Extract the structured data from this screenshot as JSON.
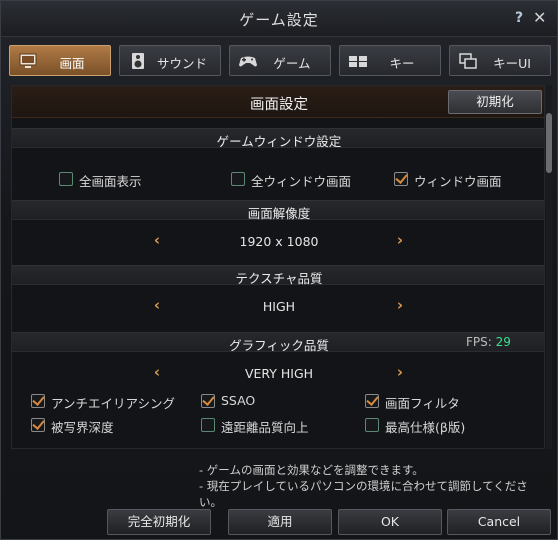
{
  "window": {
    "title": "ゲーム設定",
    "help": "?",
    "close": "✕"
  },
  "tabs": [
    {
      "label": "画面",
      "icon": "monitor-icon",
      "active": true
    },
    {
      "label": "サウンド",
      "icon": "speaker-icon",
      "active": false
    },
    {
      "label": "ゲーム",
      "icon": "gamepad-icon",
      "active": false
    },
    {
      "label": "キー",
      "icon": "keyboard-icon",
      "active": false
    },
    {
      "label": "キーUI",
      "icon": "windows-icon",
      "active": false
    }
  ],
  "panel": {
    "title": "画面設定",
    "reset_label": "初期化",
    "window_section": {
      "label": "ゲームウィンドウ設定",
      "options": [
        {
          "label": "全画面表示",
          "checked": false
        },
        {
          "label": "全ウィンドウ画面",
          "checked": false
        },
        {
          "label": "ウィンドウ画面",
          "checked": true
        }
      ]
    },
    "resolution": {
      "label": "画面解像度",
      "value": "1920 x 1080"
    },
    "texture": {
      "label": "テクスチャ品質",
      "value": "HIGH"
    },
    "graphics": {
      "label": "グラフィック品質",
      "fps_label": "FPS:",
      "fps_value": "29",
      "value": "VERY HIGH",
      "options": [
        {
          "label": "アンチエイリアシング",
          "checked": true
        },
        {
          "label": "SSAO",
          "checked": true
        },
        {
          "label": "画面フィルタ",
          "checked": true
        },
        {
          "label": "被写界深度",
          "checked": true
        },
        {
          "label": "遠距離品質向上",
          "checked": false
        },
        {
          "label": "最高仕様(β版)",
          "checked": false
        }
      ]
    }
  },
  "notes": [
    "- ゲームの画面と効果などを調整できます。",
    "- 現在プレイしているパソコンの環境に合わせて調節してください。"
  ],
  "footer": {
    "full_reset": "完全初期化",
    "apply": "適用",
    "ok": "OK",
    "cancel": "Cancel"
  },
  "colors": {
    "accent": "#d68a3c",
    "fps": "#39e08a",
    "active_tab": "#b07a45"
  }
}
